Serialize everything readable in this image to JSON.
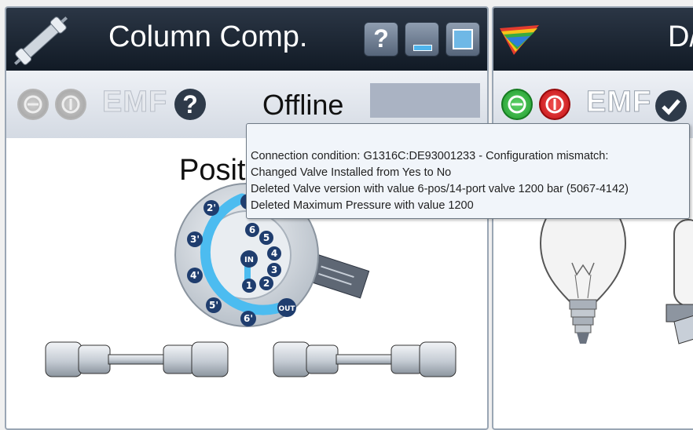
{
  "column_comp": {
    "title": "Column Comp.",
    "help_label": "?",
    "emf_label": "EMF",
    "status": "Offline",
    "position_label": "Posit",
    "valve": {
      "in_label": "IN",
      "out_label": "OUT",
      "ports": [
        "1",
        "2",
        "3",
        "4",
        "5",
        "6"
      ],
      "outer_ports": [
        "2'",
        "3'",
        "4'",
        "5'",
        "6'"
      ]
    }
  },
  "right_panel": {
    "title": "D/",
    "emf_label": "EMF"
  },
  "tooltip": {
    "lines": [
      "Connection condition: G1316C:DE93001233 - Configuration mismatch:",
      "Changed Valve Installed from Yes  to No",
      "Deleted Valve version with value 6-pos/14-port valve 1200 bar (5067-4142)",
      "Deleted Maximum Pressure with value 1200"
    ]
  },
  "colors": {
    "titlebar": "#1a2430",
    "toolbar": "#dde2e9",
    "valve_channel": "#4cbcf0",
    "port_fill": "#1f3d6e",
    "green_button": "#2eae3a",
    "red_button": "#d6191c"
  }
}
